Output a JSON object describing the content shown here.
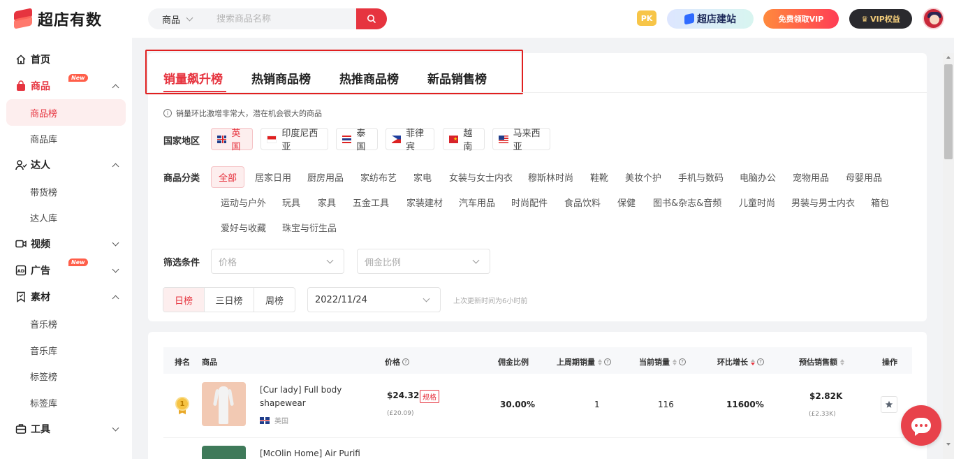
{
  "brand": {
    "name": "超店有数"
  },
  "search": {
    "category": "商品",
    "placeholder": "搜索商品名称"
  },
  "header": {
    "pk": "PK",
    "build": "超店建站",
    "free_vip": "免费领取VIP",
    "vip_rights": "VIP权益"
  },
  "sidebar": {
    "home": "首页",
    "products": "商品",
    "product_rank": "商品榜",
    "product_lib": "商品库",
    "creators": "达人",
    "creator_rank": "带货榜",
    "creator_lib": "达人库",
    "video": "视频",
    "ads": "广告",
    "materials": "素材",
    "music_rank": "音乐榜",
    "music_lib": "音乐库",
    "tag_rank": "标签榜",
    "tag_lib": "标签库",
    "tools": "工具",
    "new_badge": "New"
  },
  "tabs": [
    "销量飙升榜",
    "热销商品榜",
    "热推商品榜",
    "新品销售榜"
  ],
  "tip": "销量环比激增非常大，潜在机会很大的商品",
  "filters": {
    "region_label": "国家地区",
    "regions": [
      "英国",
      "印度尼西亚",
      "泰国",
      "菲律宾",
      "越南",
      "马来西亚"
    ],
    "category_label": "商品分类",
    "categories_row1": [
      "全部",
      "居家日用",
      "厨房用品",
      "家纺布艺",
      "家电",
      "女装与女士内衣",
      "穆斯林时尚",
      "鞋靴",
      "美妆个护",
      "手机与数码",
      "电脑办公",
      "宠物用品",
      "母婴用品"
    ],
    "categories_row2": [
      "运动与户外",
      "玩具",
      "家具",
      "五金工具",
      "家装建材",
      "汽车用品",
      "时尚配件",
      "食品饮料",
      "保健",
      "图书&杂志&音频",
      "儿童时尚",
      "男装与男士内衣",
      "箱包"
    ],
    "categories_row3": [
      "爱好与收藏",
      "珠宝与衍生品"
    ],
    "condition_label": "筛选条件",
    "price_placeholder": "价格",
    "commission_placeholder": "佣金比例",
    "periods": [
      "日榜",
      "三日榜",
      "周榜"
    ],
    "date": "2022/11/24",
    "update_note": "上次更新时间为6小时前"
  },
  "table": {
    "headers": {
      "rank": "排名",
      "product": "商品",
      "price": "价格",
      "commission": "佣金比例",
      "last_week": "上周期销量",
      "current": "当前销量",
      "growth": "环比增长",
      "est_sales": "预估销售额",
      "action": "操作"
    },
    "rows": [
      {
        "rank": "1",
        "name": "[Cur lady] Full body shapewear",
        "country": "英国",
        "price": "$24.32",
        "spec": "规格",
        "price_local": "(£20.09)",
        "commission": "30.00%",
        "last_week": "1",
        "current": "116",
        "growth": "11600%",
        "est_sales": "$2.82K",
        "est_sales_local": "(£2.33K)"
      },
      {
        "name": "[McOlin Home] Air Purifi"
      }
    ]
  }
}
